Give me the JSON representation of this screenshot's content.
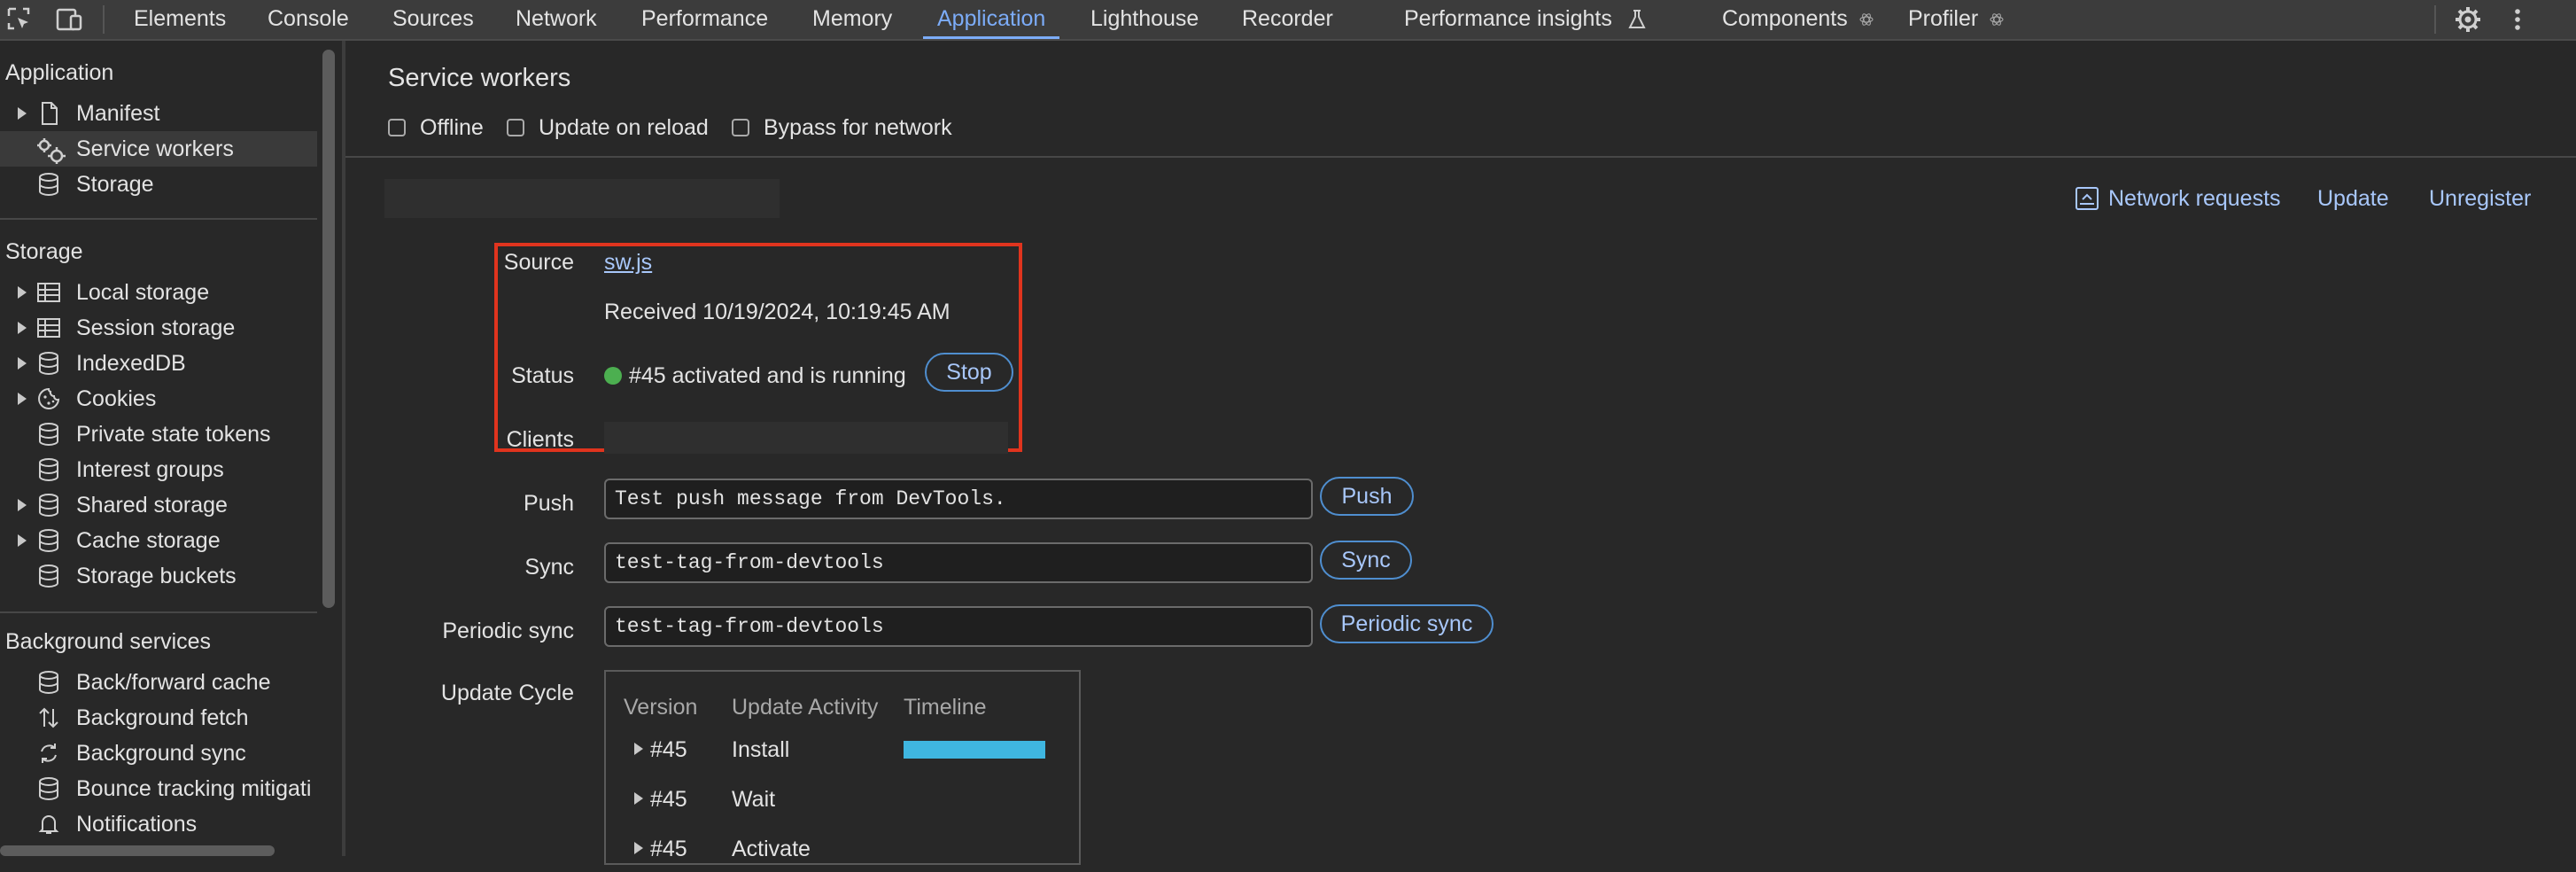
{
  "tabs": [
    "Elements",
    "Console",
    "Sources",
    "Network",
    "Performance",
    "Memory",
    "Application",
    "Lighthouse",
    "Recorder",
    "Performance insights",
    "Components",
    "Profiler"
  ],
  "active_tab": "Application",
  "icons": {
    "inspect": "inspect-element-icon",
    "device": "device-toolbar-icon",
    "flask": "experiment-flask-icon",
    "react": "react-atom-icon",
    "settings": "gear-icon",
    "more": "kebab-menu-icon"
  },
  "sidebar": {
    "application_header": "Application",
    "application_items": [
      "Manifest",
      "Service workers",
      "Storage"
    ],
    "storage_header": "Storage",
    "storage_items": [
      "Local storage",
      "Session storage",
      "IndexedDB",
      "Cookies",
      "Private state tokens",
      "Interest groups",
      "Shared storage",
      "Cache storage",
      "Storage buckets"
    ],
    "background_header": "Background services",
    "background_items": [
      "Back/forward cache",
      "Background fetch",
      "Background sync",
      "Bounce tracking mitigati",
      "Notifications"
    ]
  },
  "main": {
    "title": "Service workers",
    "options": [
      "Offline",
      "Update on reload",
      "Bypass for network"
    ],
    "actions": [
      "Network requests",
      "Update",
      "Unregister"
    ],
    "source_label": "Source",
    "source_file": "sw.js",
    "received": "Received 10/19/2024, 10:19:45 AM",
    "status_label": "Status",
    "status_text": "#45 activated and is running",
    "status_color": "#4caf50",
    "stop_button": "Stop",
    "clients_label": "Clients",
    "push_label": "Push",
    "push_value": "Test push message from DevTools.",
    "push_button": "Push",
    "sync_label": "Sync",
    "sync_value": "test-tag-from-devtools",
    "sync_button": "Sync",
    "periodic_label": "Periodic sync",
    "periodic_value": "test-tag-from-devtools",
    "periodic_button": "Periodic sync",
    "update_cycle_label": "Update Cycle",
    "update_cycle": {
      "headers": [
        "Version",
        "Update Activity",
        "Timeline"
      ],
      "rows": [
        {
          "version": "#45",
          "activity": "Install"
        },
        {
          "version": "#45",
          "activity": "Wait"
        },
        {
          "version": "#45",
          "activity": "Activate"
        }
      ],
      "timeline_color": "#3fb6e0"
    },
    "highlight_color": "#e0341e"
  }
}
